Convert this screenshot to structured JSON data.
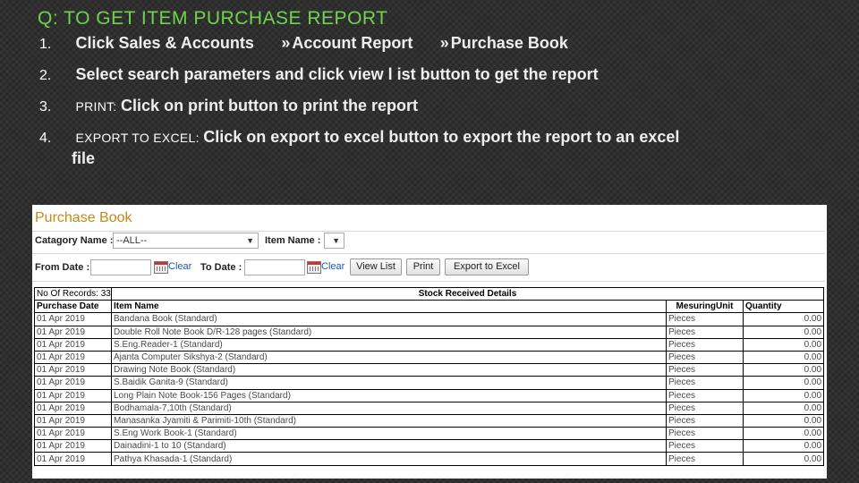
{
  "slide": {
    "title": "Q: TO GET ITEM PURCHASE REPORT",
    "steps": [
      {
        "num": "1.",
        "parts": [
          "Click Sales & Accounts",
          "Account Report",
          "Purchase Book"
        ],
        "sep": "»"
      },
      {
        "num": "2.",
        "text": "Select search parameters and click  view l ist button  to get the report"
      },
      {
        "num": "3.",
        "caps": "PRINT:",
        "text": "Click on  print button  to print  the report"
      },
      {
        "num": "4.",
        "caps": "EXPORT TO EXCEL:",
        "text": "Click on export to excel button to export the report to an excel",
        "text2": "file"
      }
    ]
  },
  "app": {
    "title": "Purchase Book",
    "filters": {
      "category_label": "Catagory Name :",
      "category_value": "--ALL--",
      "item_label": "Item Name :",
      "item_value": "",
      "from_label": "From Date :",
      "from_value": "",
      "clear1": "Clear",
      "to_label": "To Date :",
      "to_value": "",
      "clear2": "Clear"
    },
    "buttons": {
      "view_list": "View List",
      "print": "Print",
      "export": "Export to Excel"
    },
    "table": {
      "records": "No Of Records: 33",
      "caption": "Stock Received Details",
      "headers": [
        "Purchase Date",
        "Item Name",
        "MesuringUnit",
        "Quantity"
      ],
      "rows": [
        [
          "01 Apr 2019",
          "Bandana Book (Standard)",
          "Pieces",
          "0.00"
        ],
        [
          "01 Apr 2019",
          "Double Roll Note Book D/R-128 pages (Standard)",
          "Pieces",
          "0.00"
        ],
        [
          "01 Apr 2019",
          "S.Eng.Reader-1 (Standard)",
          "Pieces",
          "0.00"
        ],
        [
          "01 Apr 2019",
          "Ajanta Computer Sikshya-2 (Standard)",
          "Pieces",
          "0.00"
        ],
        [
          "01 Apr 2019",
          "Drawing Note Book (Standard)",
          "Pieces",
          "0.00"
        ],
        [
          "01 Apr 2019",
          "S.Baidik Ganita-9 (Standard)",
          "Pieces",
          "0.00"
        ],
        [
          "01 Apr 2019",
          "Long Plain Note Book-156 Pages (Standard)",
          "Pieces",
          "0.00"
        ],
        [
          "01 Apr 2019",
          "Bodhamala-7,10th (Standard)",
          "Pieces",
          "0.00"
        ],
        [
          "01 Apr 2019",
          "Manasanka Jyamiti & Parimiti-10th (Standard)",
          "Pieces",
          "0.00"
        ],
        [
          "01 Apr 2019",
          "S.Eng Work Book-1 (Standard)",
          "Pieces",
          "0.00"
        ],
        [
          "01 Apr 2019",
          "Dainadini-1 to 10 (Standard)",
          "Pieces",
          "0.00"
        ],
        [
          "01 Apr 2019",
          "Pathya Khasada-1 (Standard)",
          "Pieces",
          "0.00"
        ]
      ]
    }
  },
  "colors": {
    "title_green": "#6fd44e",
    "app_title_orange": "#c58a17",
    "link_blue": "#1a57b8"
  }
}
